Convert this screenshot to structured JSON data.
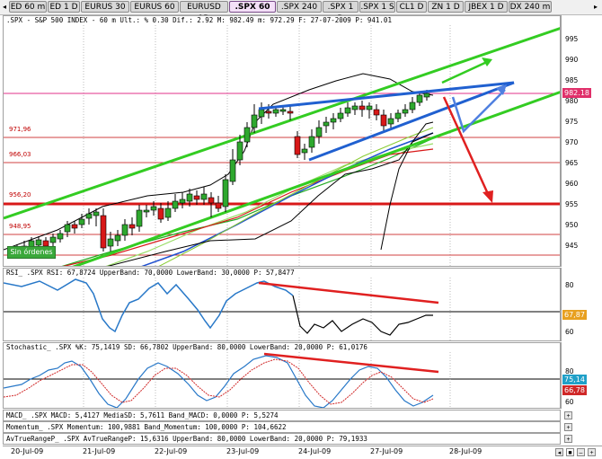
{
  "tabs": [
    "ED 60 m",
    "ED 1 D",
    "EURUS 30 m",
    "EURUS 60 m",
    "EURUSD 1D",
    ".SPX 60 m",
    ".SPX 240 m",
    ".SPX 1 D",
    ".SPX 1 S",
    "CL1 D",
    "ZN 1 D",
    "JBEX 1 D",
    "DX 240 m"
  ],
  "active_tab": ".SPX 60 m",
  "price_panel": {
    "header": ".SPX - S&P 500 INDEX - 60 m Ult.: % 0.30 Dif.: 2.92 M: 982.49 m: 972.29 F: 27-07-2009 P: 941.01",
    "current_price": "982.18",
    "left_levels": [
      "971,96",
      "966,03",
      "956,20",
      "948,95"
    ],
    "order_button": "Sin órdenes",
    "y_ticks": [
      "995",
      "990",
      "985",
      "980",
      "975",
      "970",
      "965",
      "960",
      "955",
      "950",
      "945"
    ]
  },
  "rsi_panel": {
    "header": "RSI_ .SPX RSI: 67,8724 UpperBand: 70,0000 LowerBand: 30,0000 P: 57,8477",
    "value_box": "67,87",
    "y_ticks": [
      "80",
      "60"
    ]
  },
  "stoch_panel": {
    "header": "Stochastic_ .SPX %K: 75,1419 SD: 66,7802 UpperBand: 80,0000 LowerBand: 20,0000 P: 61,0176",
    "value_box_1": "75,14",
    "value_box_2": "66,78",
    "y_ticks": [
      "80",
      "60"
    ]
  },
  "macd_header": "MACD_ .SPX MACD: 5,4127 MediaSD: 5,7611 Band_MACD: 0,0000 P: 5,5274",
  "momentum_header": "Momentum_ .SPX Momentum: 100,9881 Band_Momentum: 100,0000 P: 104,6622",
  "avtr_header": "AvTrueRangeP_ .SPX AvTrueRangeP: 15,6316 UpperBand: 80,0000 LowerBand: 20,0000 P: 79,1933",
  "x_labels": [
    "20-Jul-09",
    "21-Jul-09",
    "22-Jul-09",
    "23-Jul-09",
    "24-Jul-09",
    "27-Jul-09",
    "28-Jul-09"
  ],
  "colors": {
    "bull": "#2ea82e",
    "bear": "#d81818",
    "trend_green": "#33cc22",
    "trend_blue": "#2060d0",
    "arrow_red": "#e02020",
    "magenta": "#e0308a",
    "price_box": "#e0306a"
  }
}
